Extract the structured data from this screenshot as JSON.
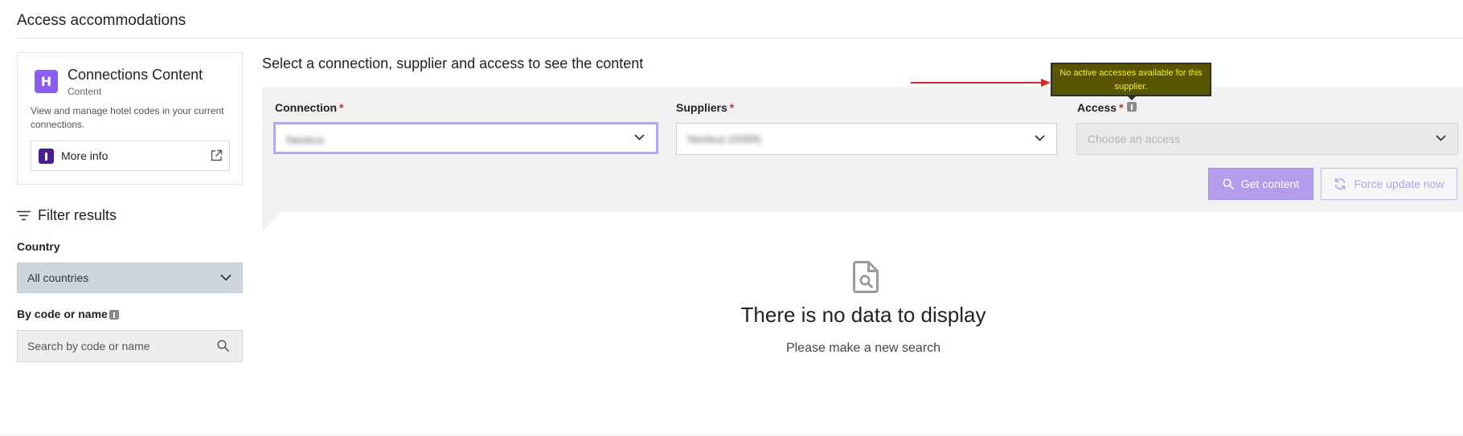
{
  "page": {
    "title": "Access accommodations"
  },
  "app_card": {
    "logo_letter": "H",
    "name": "Connections Content",
    "subtitle": "Content",
    "description": "View and manage hotel codes in your current connections.",
    "more_info_label": "More info"
  },
  "filters": {
    "title": "Filter results",
    "country_label": "Country",
    "country_value": "All countries",
    "code_label": "By code or name",
    "code_placeholder": "Search by code or name"
  },
  "main": {
    "heading": "Select a connection, supplier and access to see the content",
    "connection": {
      "label": "Connection",
      "required": "*",
      "value": "Nexbus"
    },
    "suppliers": {
      "label": "Suppliers",
      "required": "*",
      "value": "Nexbus (0069)"
    },
    "access": {
      "label": "Access",
      "required": "*",
      "placeholder": "Choose an access"
    },
    "get_content_label": "Get content",
    "force_update_label": "Force update now",
    "tooltip": "No active accesses available for this supplier.",
    "empty_title": "There is no data to display",
    "empty_subtitle": "Please make a new search"
  },
  "colors": {
    "accent": "#8b5cf6",
    "primary_button": "#b39ceb",
    "tooltip_bg": "#595500",
    "tooltip_text": "#f6ee2a",
    "annotation_arrow": "#e02424",
    "required": "#d62828"
  },
  "icons": [
    "app-logo-icon",
    "info-icon",
    "external-link-icon",
    "filter-icon",
    "chevron-down-icon",
    "search-icon",
    "refresh-icon",
    "file-search-icon"
  ]
}
